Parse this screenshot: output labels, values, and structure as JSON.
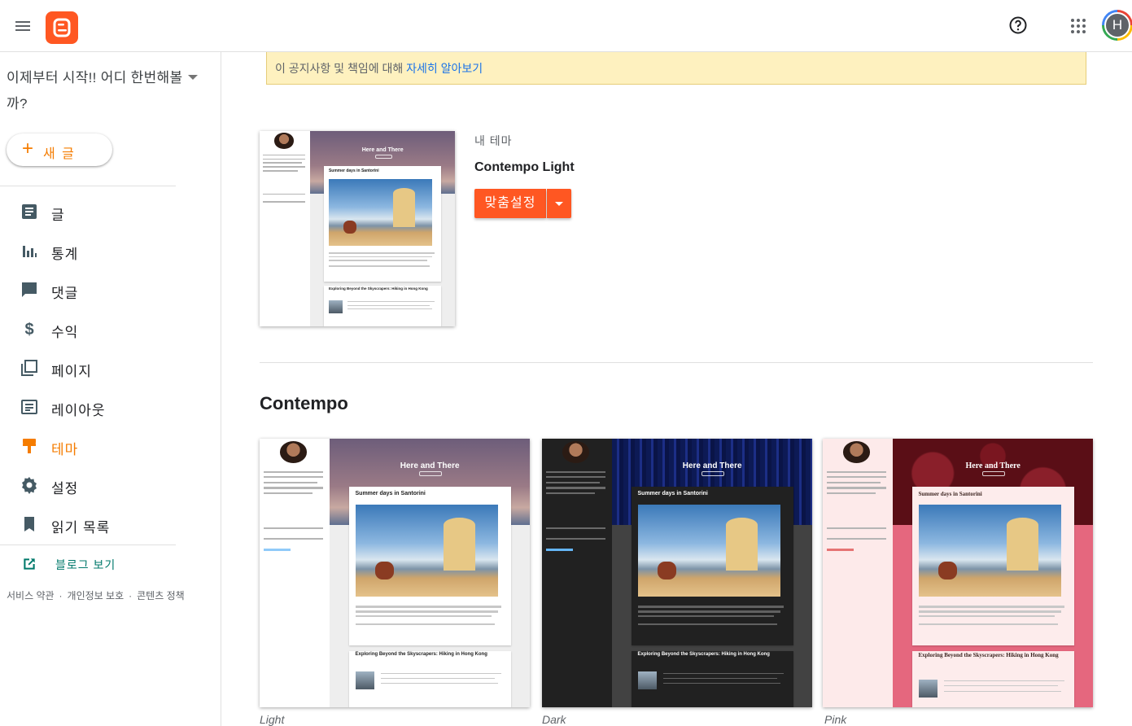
{
  "header": {
    "menu_icon": "hamburger-menu-icon",
    "logo_icon": "blogger-logo-icon",
    "help_icon": "help-circle-icon",
    "apps_icon": "apps-grid-icon",
    "avatar_letter": "H"
  },
  "sidebar": {
    "blog_title": "이제부터 시작!! 어디 한번해볼까?",
    "new_post_label": "새 글",
    "items": [
      {
        "label": "글",
        "icon": "posts-icon"
      },
      {
        "label": "통계",
        "icon": "stats-icon"
      },
      {
        "label": "댓글",
        "icon": "comments-icon"
      },
      {
        "label": "수익",
        "icon": "dollar-icon"
      },
      {
        "label": "페이지",
        "icon": "pages-icon"
      },
      {
        "label": "레이아웃",
        "icon": "layout-icon"
      },
      {
        "label": "테마",
        "icon": "theme-paint-icon",
        "active": true
      },
      {
        "label": "설정",
        "icon": "settings-gear-icon"
      },
      {
        "label": "읽기 목록",
        "icon": "bookmark-icon"
      }
    ],
    "view_blog_label": "블로그 보기",
    "footer": {
      "terms": "서비스 약관",
      "privacy": "개인정보 보호",
      "content_policy": "콘텐츠 정책",
      "separator": "·"
    }
  },
  "notice": {
    "text": "이 공지사항 및 책임에 대해 ",
    "link": "자세히 알아보기"
  },
  "my_theme": {
    "section_label": "내 테마",
    "name": "Contempo Light",
    "customize_label": "맞춤설정"
  },
  "gallery": {
    "title": "Contempo",
    "themes": [
      {
        "name": "Light"
      },
      {
        "name": "Dark"
      },
      {
        "name": "Pink"
      }
    ]
  },
  "preview": {
    "blog_title": "Here and There",
    "post1_title": "Summer days in Santorini",
    "post2_title": "Exploring Beyond the Skyscrapers: Hiking in Hong Kong"
  },
  "colors": {
    "accent": "#ff5722",
    "active_nav": "#f57c00",
    "link": "#1a73e8",
    "view_blog": "#00796b",
    "notice_bg": "#fef1bf"
  }
}
